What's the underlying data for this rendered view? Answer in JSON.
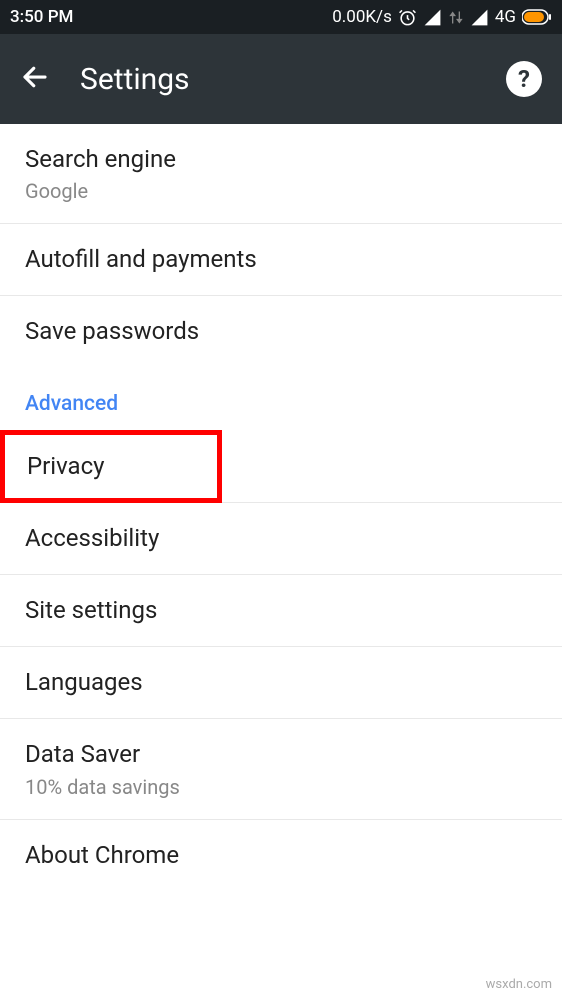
{
  "status_bar": {
    "time": "3:50 PM",
    "data_rate": "0.00K/s",
    "network_label": "4G"
  },
  "app_bar": {
    "title": "Settings"
  },
  "section1": {
    "search_engine_label": "Search engine",
    "search_engine_value": "Google",
    "autofill_label": "Autofill and payments",
    "save_passwords_label": "Save passwords"
  },
  "advanced_header": "Advanced",
  "advanced": {
    "privacy_label": "Privacy",
    "accessibility_label": "Accessibility",
    "site_settings_label": "Site settings",
    "languages_label": "Languages",
    "data_saver_label": "Data Saver",
    "data_saver_subtitle": "10% data savings",
    "about_label": "About Chrome"
  },
  "watermark": "wsxdn.com"
}
